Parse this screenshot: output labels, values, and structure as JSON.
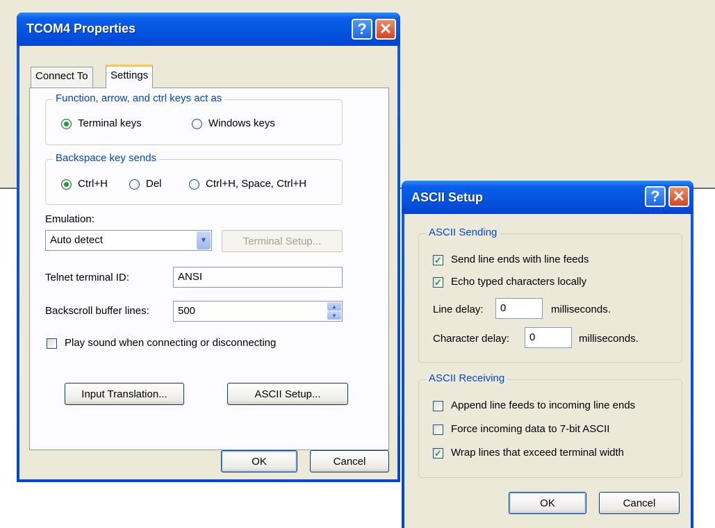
{
  "main_window": {
    "title": "TCOM4 Properties",
    "help_glyph": "?",
    "close_glyph": "✕",
    "tabs": [
      {
        "label": "Connect To"
      },
      {
        "label": "Settings"
      }
    ],
    "function_keys_group": {
      "title": "Function, arrow, and ctrl keys act as",
      "options": [
        {
          "label": "Terminal keys",
          "checked": true
        },
        {
          "label": "Windows keys",
          "checked": false
        }
      ]
    },
    "backspace_group": {
      "title": "Backspace key sends",
      "options": [
        {
          "label": "Ctrl+H",
          "checked": true
        },
        {
          "label": "Del",
          "checked": false
        },
        {
          "label": "Ctrl+H, Space, Ctrl+H",
          "checked": false
        }
      ]
    },
    "emulation_label": "Emulation:",
    "emulation_value": "Auto detect",
    "terminal_setup_label": "Terminal Setup...",
    "telnet_id_label": "Telnet terminal ID:",
    "telnet_id_value": "ANSI",
    "backscroll_label": "Backscroll buffer lines:",
    "backscroll_value": "500",
    "play_sound_label": "Play sound when connecting or disconnecting",
    "input_translation_label": "Input Translation...",
    "ascii_setup_label": "ASCII Setup...",
    "ok_label": "OK",
    "cancel_label": "Cancel"
  },
  "ascii_dialog": {
    "title": "ASCII Setup",
    "help_glyph": "?",
    "close_glyph": "✕",
    "sending_group": {
      "title": "ASCII Sending",
      "send_line_ends": "Send line ends with line feeds",
      "echo_typed": "Echo typed characters locally",
      "line_delay_label": "Line delay:",
      "line_delay_value": "0",
      "char_delay_label": "Character delay:",
      "char_delay_value": "0",
      "milliseconds": "milliseconds."
    },
    "receiving_group": {
      "title": "ASCII Receiving",
      "append_line_feeds": "Append line feeds to incoming line ends",
      "force_7bit": "Force incoming data to 7-bit ASCII",
      "wrap_lines": "Wrap lines that exceed terminal width"
    },
    "check_glyph": "✓",
    "ok_label": "OK",
    "cancel_label": "Cancel"
  }
}
